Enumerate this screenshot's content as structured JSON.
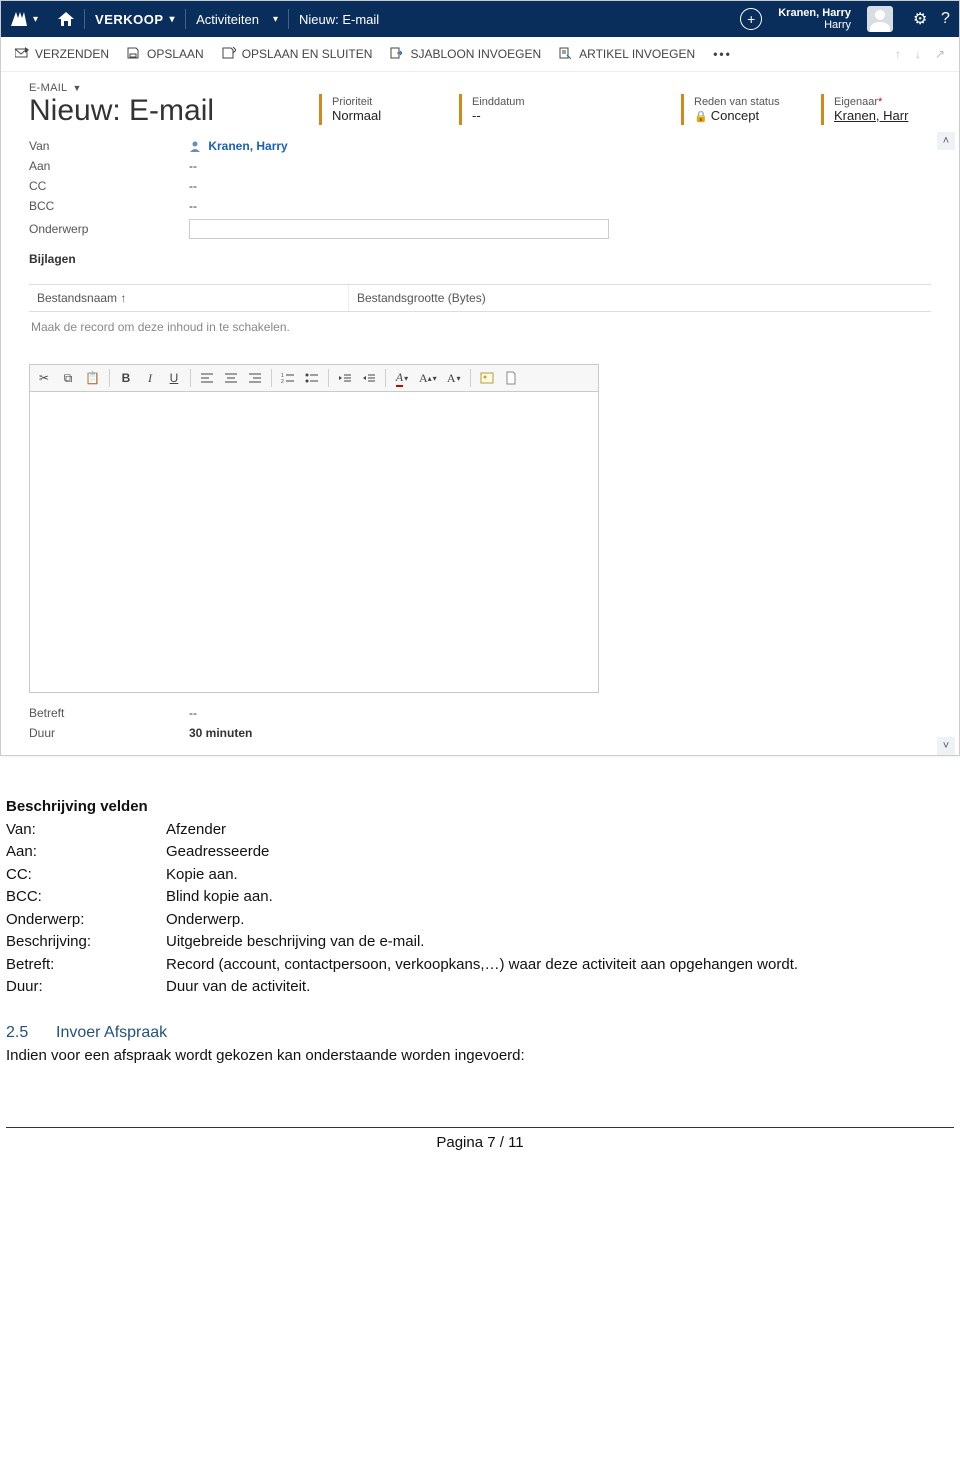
{
  "topnav": {
    "sales": "VERKOOP",
    "activities": "Activiteiten",
    "breadcrumb": "Nieuw: E-mail",
    "user_line1": "Kranen, Harry",
    "user_line2": "Harry"
  },
  "cmdbar": {
    "send": "VERZENDEN",
    "save": "OPSLAAN",
    "save_close": "OPSLAAN EN SLUITEN",
    "tpl": "SJABLOON INVOEGEN",
    "article": "ARTIKEL INVOEGEN"
  },
  "header": {
    "entity_label": "E-MAIL",
    "title": "Nieuw: E-mail",
    "priority_lbl": "Prioriteit",
    "priority_val": "Normaal",
    "end_lbl": "Einddatum",
    "end_val": "--",
    "status_lbl": "Reden van status",
    "status_val": "Concept",
    "owner_lbl": "Eigenaar",
    "owner_val": "Kranen, Harr"
  },
  "fields": {
    "van_lbl": "Van",
    "van_val": "Kranen, Harry",
    "aan_lbl": "Aan",
    "aan_val": "--",
    "cc_lbl": "CC",
    "cc_val": "--",
    "bcc_lbl": "BCC",
    "bcc_val": "--",
    "sub_lbl": "Onderwerp",
    "att_lbl": "Bijlagen",
    "col_name": "Bestandsnaam",
    "col_size": "Bestandsgrootte (Bytes)",
    "att_msg": "Maak de record om deze inhoud in te schakelen.",
    "betreft_lbl": "Betreft",
    "betreft_val": "--",
    "duur_lbl": "Duur",
    "duur_val": "30 minuten"
  },
  "rte": {
    "b": "B",
    "i": "I",
    "u": "U"
  },
  "doc": {
    "heading": "Beschrijving velden",
    "rows": {
      "van": {
        "l": "Van:",
        "v": "Afzender"
      },
      "aan": {
        "l": "Aan:",
        "v": "Geadresseerde"
      },
      "cc": {
        "l": "CC:",
        "v": "Kopie aan."
      },
      "bcc": {
        "l": "BCC:",
        "v": "Blind kopie aan."
      },
      "onder": {
        "l": "Onderwerp:",
        "v": "Onderwerp."
      },
      "besch": {
        "l": "Beschrijving:",
        "v": "Uitgebreide beschrijving van de e-mail."
      },
      "betr": {
        "l": "Betreft:",
        "v": "Record (account, contactpersoon, verkoopkans,…) waar deze activiteit aan opgehangen wordt."
      },
      "duur": {
        "l": "Duur:",
        "v": "Duur van de activiteit."
      }
    },
    "sec_num": "2.5",
    "sec_title": "Invoer Afspraak",
    "sec_text": "Indien voor een afspraak wordt gekozen kan onderstaande worden ingevoerd:",
    "footer": "Pagina 7 / 11"
  }
}
